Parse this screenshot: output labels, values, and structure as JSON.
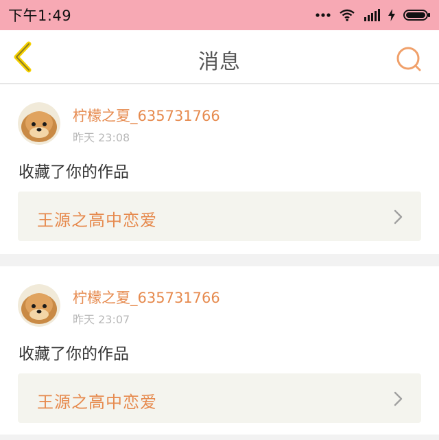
{
  "status_bar": {
    "time": "下午1:49",
    "icons": [
      "more-dots-icon",
      "wifi-icon",
      "signal-icon",
      "charging-icon",
      "battery-icon"
    ]
  },
  "header": {
    "title": "消息",
    "back_icon": "chevron-left-icon",
    "search_icon": "search-icon"
  },
  "messages": [
    {
      "username": "柠檬之夏_635731766",
      "time": "昨天 23:08",
      "action": "收藏了你的作品",
      "work_title": "王源之高中恋爱"
    },
    {
      "username": "柠檬之夏_635731766",
      "time": "昨天 23:07",
      "action": "收藏了你的作品",
      "work_title": "王源之高中恋爱"
    }
  ],
  "colors": {
    "status_bar": "#f7a9b4",
    "accent": "#e68a4e",
    "back_icon": "#f5d000",
    "search_icon": "#f0a06a"
  }
}
